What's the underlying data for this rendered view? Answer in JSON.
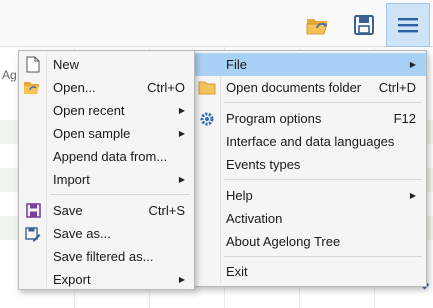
{
  "background": {
    "column_header_fragment": "Ag"
  },
  "toolbar": {
    "open_folder_icon": "folder-open-icon",
    "save_icon": "floppy-disk-icon",
    "menu_icon": "hamburger-menu-icon"
  },
  "main_menu": {
    "items": [
      {
        "label": "File",
        "shortcut": "",
        "has_submenu": true,
        "icon": ""
      },
      {
        "label": "Open documents folder",
        "shortcut": "Ctrl+D",
        "has_submenu": false,
        "icon": "folder-icon"
      },
      {
        "label": "Program options",
        "shortcut": "F12",
        "has_submenu": false,
        "icon": "gear-icon"
      },
      {
        "label": "Interface and data languages",
        "shortcut": "",
        "has_submenu": false,
        "icon": ""
      },
      {
        "label": "Events types",
        "shortcut": "",
        "has_submenu": false,
        "icon": ""
      },
      {
        "label": "Help",
        "shortcut": "",
        "has_submenu": true,
        "icon": ""
      },
      {
        "label": "Activation",
        "shortcut": "",
        "has_submenu": false,
        "icon": ""
      },
      {
        "label": "About Agelong Tree",
        "shortcut": "",
        "has_submenu": false,
        "icon": ""
      },
      {
        "label": "Exit",
        "shortcut": "",
        "has_submenu": false,
        "icon": ""
      }
    ]
  },
  "file_menu": {
    "items": [
      {
        "label": "New",
        "shortcut": "",
        "has_submenu": false,
        "icon": "new-document-icon"
      },
      {
        "label": "Open...",
        "shortcut": "Ctrl+O",
        "has_submenu": false,
        "icon": "open-folder-icon"
      },
      {
        "label": "Open recent",
        "shortcut": "",
        "has_submenu": true,
        "icon": ""
      },
      {
        "label": "Open sample",
        "shortcut": "",
        "has_submenu": true,
        "icon": ""
      },
      {
        "label": "Append data from...",
        "shortcut": "",
        "has_submenu": false,
        "icon": ""
      },
      {
        "label": "Import",
        "shortcut": "",
        "has_submenu": true,
        "icon": ""
      },
      {
        "label": "Save",
        "shortcut": "Ctrl+S",
        "has_submenu": false,
        "icon": "save-icon"
      },
      {
        "label": "Save as...",
        "shortcut": "",
        "has_submenu": false,
        "icon": "save-as-icon"
      },
      {
        "label": "Save filtered as...",
        "shortcut": "",
        "has_submenu": false,
        "icon": ""
      },
      {
        "label": "Export",
        "shortcut": "",
        "has_submenu": true,
        "icon": ""
      }
    ]
  },
  "colors": {
    "highlight": "#a9d1f5",
    "active_toolbar": "#cfe3f6",
    "menu_bg": "#f5f5f5",
    "accent_blue": "#3b6fb5"
  }
}
